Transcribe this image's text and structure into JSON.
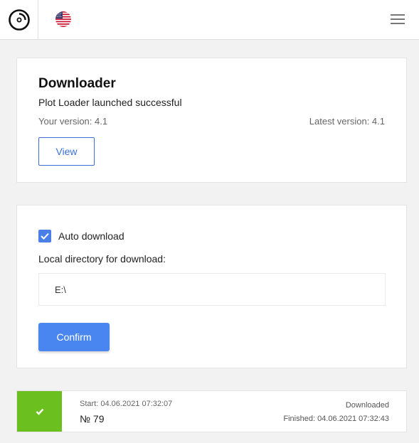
{
  "header": {
    "logo_icon": "disc-logo-icon",
    "flag_icon": "us-flag-icon",
    "menu_icon": "hamburger-menu-icon"
  },
  "downloader": {
    "title": "Downloader",
    "subtitle": "Plot Loader launched successful",
    "your_version": "Your version: 4.1",
    "latest_version": "Latest version: 4.1",
    "view_label": "View"
  },
  "settings": {
    "auto_download_checked": true,
    "auto_download_label": "Auto download",
    "dir_label": "Local directory for download:",
    "dir_value": "E:\\",
    "confirm_label": "Confirm"
  },
  "job": {
    "status_icon": "check-icon",
    "start": "Start: 04.06.2021 07:32:07",
    "number": "№ 79",
    "status": "Downloaded",
    "finished": "Finished: 04.06.2021 07:32:43",
    "status_color": "#6bbf1f"
  },
  "colors": {
    "accent": "#4a86f0",
    "outline": "#3a6fd9"
  }
}
